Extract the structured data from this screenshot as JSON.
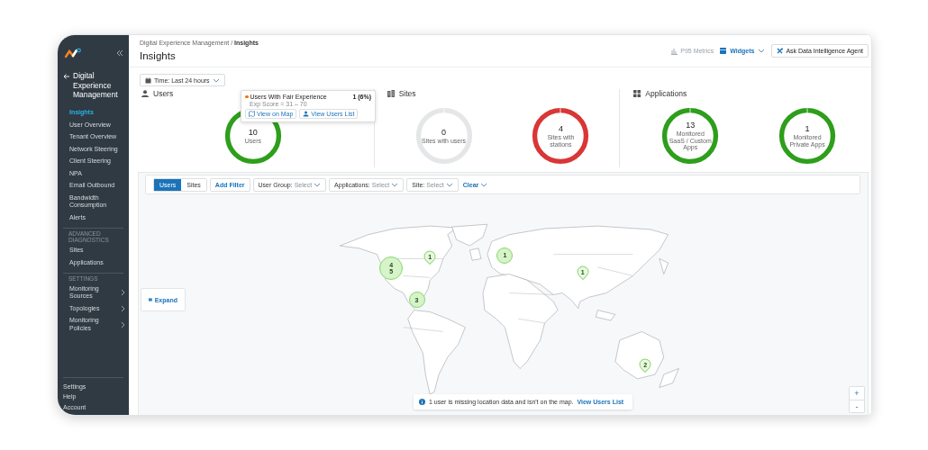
{
  "sidebar": {
    "back_title": "Digital Experience Management",
    "items": [
      {
        "kind": "link",
        "label": "Insights",
        "selected": true,
        "expandable": false
      },
      {
        "kind": "link",
        "label": "User Overview",
        "selected": false,
        "expandable": false
      },
      {
        "kind": "link",
        "label": "Tenant Overview",
        "selected": false,
        "expandable": false
      },
      {
        "kind": "link",
        "label": "Network Steering",
        "selected": false,
        "expandable": false
      },
      {
        "kind": "link",
        "label": "Client Steering",
        "selected": false,
        "expandable": false
      },
      {
        "kind": "link",
        "label": "NPA",
        "selected": false,
        "expandable": false
      },
      {
        "kind": "link",
        "label": "Email Outbound",
        "selected": false,
        "expandable": false
      },
      {
        "kind": "link",
        "label": "Bandwidth Consumption",
        "selected": false,
        "expandable": false
      },
      {
        "kind": "link",
        "label": "Alerts",
        "selected": false,
        "expandable": false
      },
      {
        "kind": "heading",
        "label": "ADVANCED DIAGNOSTICS"
      },
      {
        "kind": "link",
        "label": "Sites",
        "selected": false,
        "expandable": false
      },
      {
        "kind": "link",
        "label": "Applications",
        "selected": false,
        "expandable": false
      },
      {
        "kind": "heading",
        "label": "SETTINGS"
      },
      {
        "kind": "link",
        "label": "Monitoring Sources",
        "selected": false,
        "expandable": true
      },
      {
        "kind": "link",
        "label": "Topologies",
        "selected": false,
        "expandable": true
      },
      {
        "kind": "link",
        "label": "Monitoring Policies",
        "selected": false,
        "expandable": true
      }
    ],
    "footer": [
      "Settings",
      "Help",
      "Account"
    ]
  },
  "breadcrumb": "Digital Experience Management / **Insights**",
  "title": "Insights",
  "header_actions": {
    "metrics": {
      "label": "P95 Metrics",
      "disabled": true
    },
    "widgets": "Widgets",
    "agent": "Ask Data Intelligence Agent"
  },
  "time_filter": "Time: Last 24 hours",
  "summary": [
    {
      "title": "Users",
      "donuts": [
        {
          "value": "10",
          "label": "Users",
          "color": "#2e9e1b"
        }
      ]
    },
    {
      "title": "Sites",
      "donuts": [
        {
          "value": "0",
          "label": "Sites with users",
          "color": "#e4e6e8"
        },
        {
          "value": "4",
          "label": "Sites with stations",
          "color": "#d93636"
        }
      ]
    },
    {
      "title": "Applications",
      "donuts": [
        {
          "value": "13",
          "label": "Monitored SaaS / Custom Apps",
          "color": "#2e9e1b"
        },
        {
          "value": "1",
          "label": "Monitored Private Apps",
          "color": "#2e9e1b"
        }
      ]
    }
  ],
  "tooltip": {
    "title": "Users With Fair Experience",
    "color": "#f0750f",
    "count": "1 (6%)",
    "subtitle": "Exp Score = 31 – 70",
    "actions": [
      "View on Map",
      "View Users List"
    ]
  },
  "map_filters": {
    "toggle": [
      {
        "label": "Users",
        "selected": true
      },
      {
        "label": "Sites",
        "selected": false
      }
    ],
    "add_filter": "Add Filter",
    "dropdowns": [
      {
        "label": "User Group:",
        "value": "Select"
      },
      {
        "label": "Applications:",
        "value": "Select"
      },
      {
        "label": "Site:",
        "value": "Select"
      }
    ],
    "clear": "Clear"
  },
  "map": {
    "markers": [
      {
        "kind": "cluster",
        "label": "4 5"
      },
      {
        "kind": "pin",
        "label": "1"
      },
      {
        "kind": "cluster",
        "label": "1"
      },
      {
        "kind": "cluster",
        "label": "3"
      },
      {
        "kind": "pin",
        "label": "1"
      },
      {
        "kind": "pin",
        "label": "2"
      }
    ],
    "expand": "Expand",
    "notice": {
      "text": "1 user is missing location data and isn't on the map.",
      "link": "View Users List"
    },
    "zoom": [
      "+",
      "-"
    ]
  }
}
